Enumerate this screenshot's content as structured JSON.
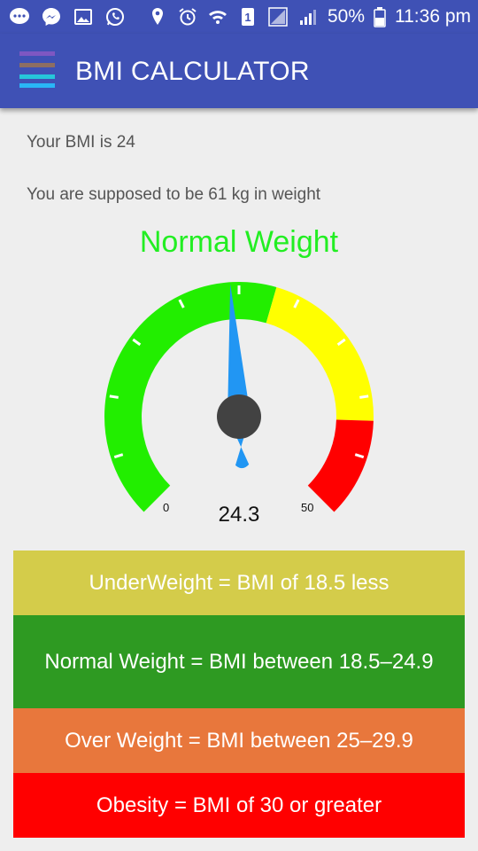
{
  "status_bar": {
    "icons_left": [
      "chat-bubble-icon",
      "messenger-icon",
      "image-icon",
      "whatsapp-icon"
    ],
    "icons_right": [
      "location-icon",
      "alarm-icon",
      "wifi-icon",
      "sim-1-icon",
      "signal-icon",
      "signal-icon"
    ],
    "battery_percent": "50%",
    "time": "11:36 pm"
  },
  "app_bar": {
    "title": "BMI CALCULATOR",
    "menu_colors": [
      "#7e57c2",
      "#8d6e63",
      "#26c6da",
      "#29b6f6"
    ]
  },
  "result": {
    "bmi_text": "Your BMI is 24",
    "weight_text": "You are supposed to be 61 kg in weight",
    "category": "Normal Weight"
  },
  "gauge": {
    "value_label": "24.3",
    "value": 24.3,
    "min_label": "0",
    "max_label": "50",
    "min": 0,
    "max": 50,
    "zones": [
      {
        "from": 0,
        "to": 28,
        "color": "#22ee00"
      },
      {
        "from": 28,
        "to": 42,
        "color": "#ffff00"
      },
      {
        "from": 42,
        "to": 50,
        "color": "#ff0000"
      }
    ],
    "needle_color": "#2196f3",
    "hub_color": "#424242"
  },
  "legend": {
    "underweight": {
      "text": "UnderWeight = BMI of 18.5 less",
      "color": "#d4cc4a"
    },
    "normal": {
      "text": "Normal Weight = BMI between 18.5–24.9",
      "color": "#2e9a22"
    },
    "over": {
      "text": "Over Weight = BMI between 25–29.9",
      "color": "#e8773c"
    },
    "obesity": {
      "text": "Obesity = BMI of 30 or greater",
      "color": "#ff0000"
    }
  }
}
